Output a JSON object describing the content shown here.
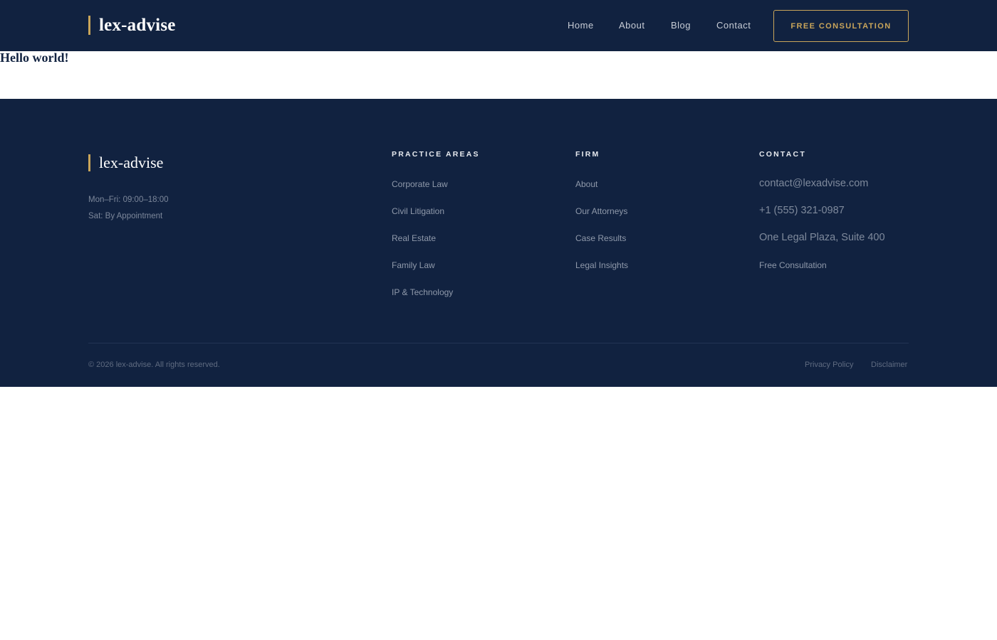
{
  "header": {
    "brand": "lex-advise",
    "nav": [
      {
        "label": "Home"
      },
      {
        "label": "About"
      },
      {
        "label": "Blog"
      },
      {
        "label": "Contact"
      }
    ],
    "cta_label": "FREE CONSULTATION"
  },
  "main": {
    "heading": "Hello world!"
  },
  "footer": {
    "brand": "lex-advise",
    "hours": [
      "Mon–Fri: 09:00–18:00",
      "Sat: By Appointment"
    ],
    "practice_areas": {
      "heading": "PRACTICE AREAS",
      "links": [
        "Corporate Law",
        "Civil Litigation",
        "Real Estate",
        "Family Law",
        "IP & Technology"
      ]
    },
    "firm": {
      "heading": "FIRM",
      "links": [
        "About",
        "Our Attorneys",
        "Case Results",
        "Legal Insights"
      ]
    },
    "contact": {
      "heading": "CONTACT",
      "email": "contact@lexadvise.com",
      "phone": "+1 (555) 321-0987",
      "address": "One Legal Plaza, Suite 400",
      "link": "Free Consultation"
    },
    "copyright": "© 2026 lex-advise. All rights reserved.",
    "legal_links": [
      "Privacy Policy",
      "Disclaimer"
    ]
  },
  "colors": {
    "navy": "#112240",
    "gold": "#c9a55a",
    "white": "#ffffff"
  }
}
